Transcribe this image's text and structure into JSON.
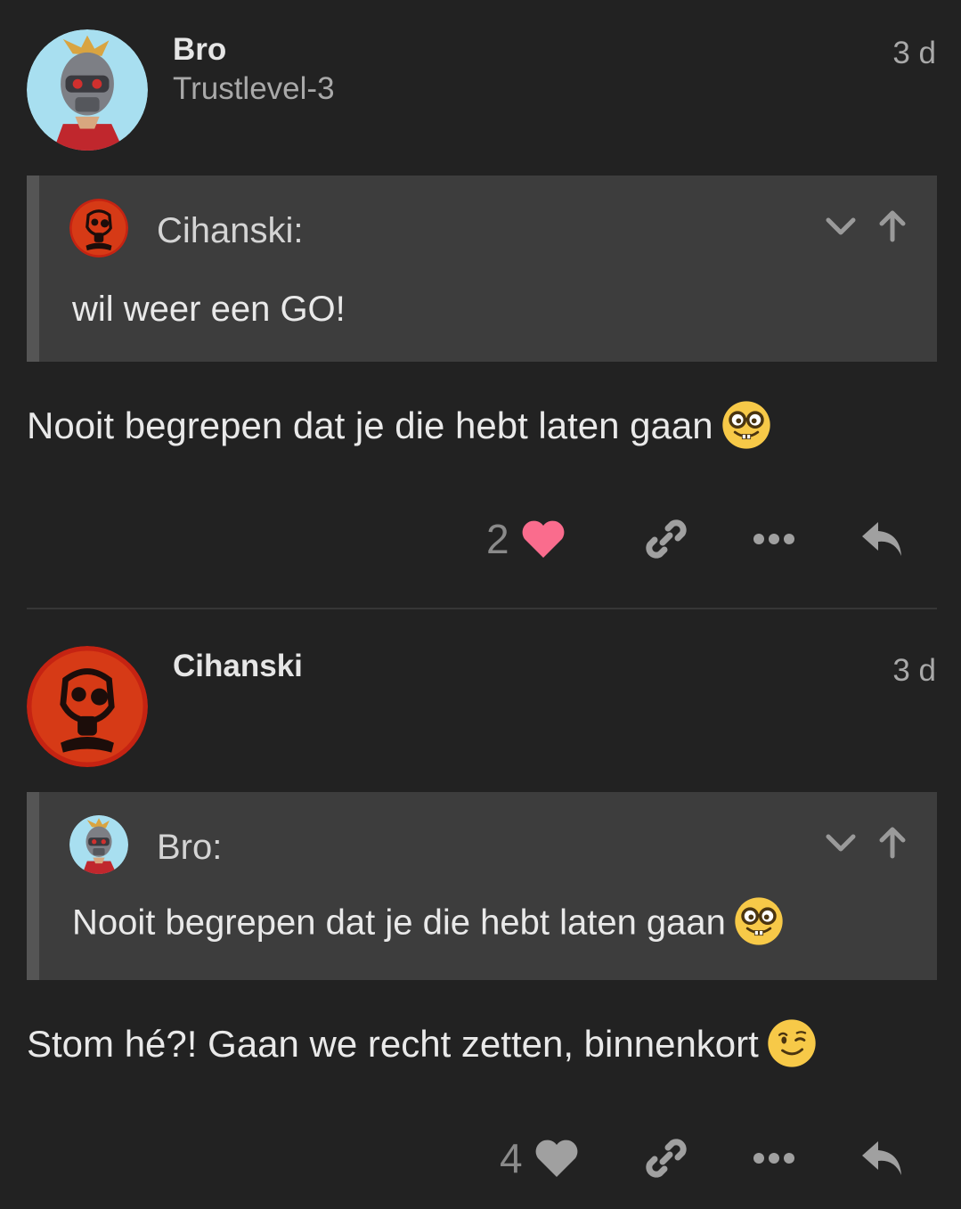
{
  "posts": [
    {
      "username": "Bro",
      "subtitle": "Trustlevel-3",
      "date": "3 d",
      "quote": {
        "author": "Cihanski:",
        "text": "wil weer een GO!"
      },
      "body": "Nooit begrepen dat je die hebt laten gaan",
      "body_emoji": "nerd-face",
      "likes": "2",
      "liked": true
    },
    {
      "username": "Cihanski",
      "subtitle": "",
      "date": "3 d",
      "quote": {
        "author": "Bro:",
        "text": "Nooit begrepen dat je die hebt laten gaan"
      },
      "body": "Stom hé?! Gaan we recht zetten, binnenkort",
      "body_emoji": "winking-face",
      "likes": "4",
      "liked": false
    }
  ],
  "colors": {
    "background": "#222222",
    "quote_bg": "#3d3d3d",
    "like_active": "#fa6c8d",
    "icon_gray": "#a0a0a0"
  }
}
